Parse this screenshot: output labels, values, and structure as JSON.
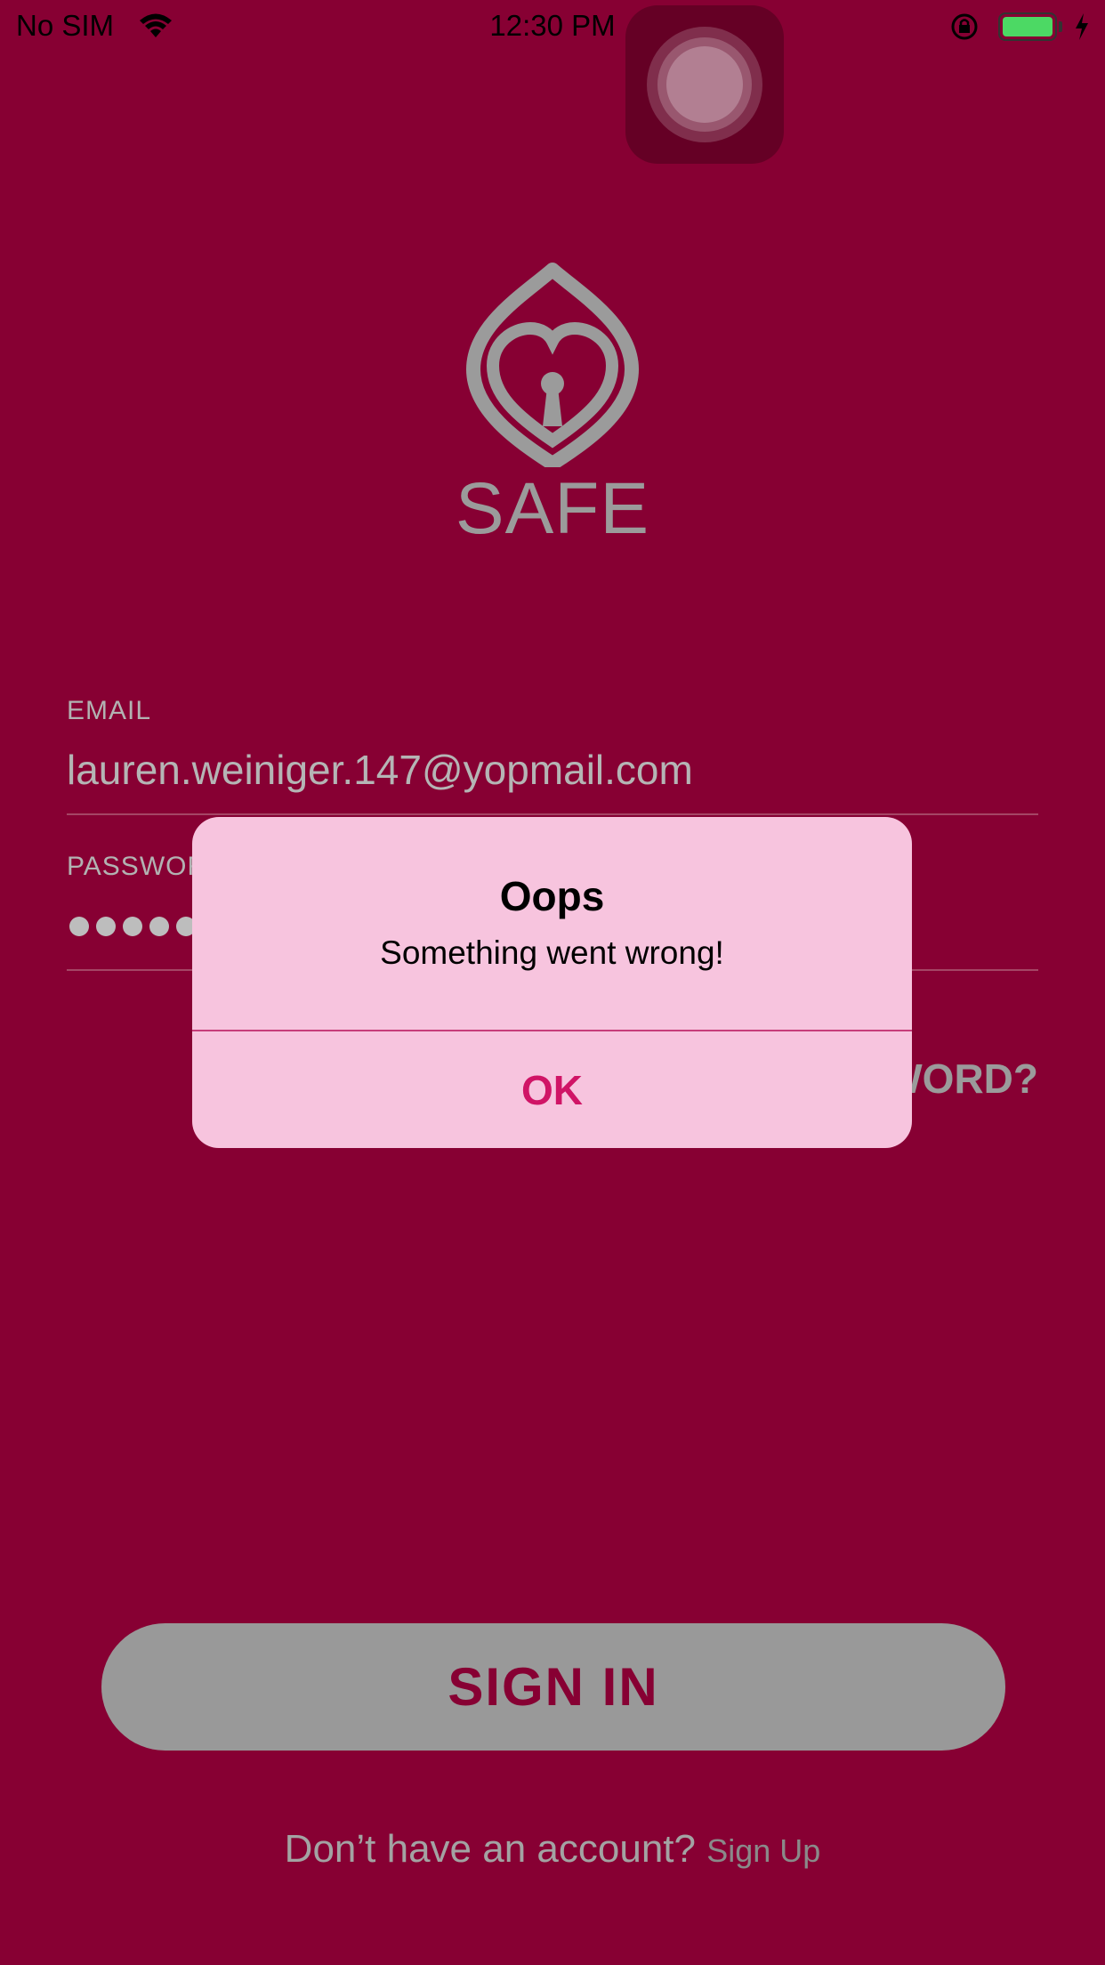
{
  "status_bar": {
    "carrier": "No SIM",
    "time": "12:30 PM"
  },
  "logo": {
    "text": "SAFE"
  },
  "form": {
    "email_label": "EMAIL",
    "email_value": "lauren.weiniger.147@yopmail.com",
    "password_label": "PASSWORD",
    "password_dots": 5,
    "forgot_password": "FORGOT PASSWORD?"
  },
  "signin_label": "SIGN IN",
  "signup": {
    "prompt": "Don’t have an account?",
    "link": "Sign Up"
  },
  "alert": {
    "title": "Oops",
    "message": "Something went wrong!",
    "ok_label": "OK"
  },
  "colors": {
    "background": "#870033",
    "alert_background": "#f7c4de",
    "alert_button": "#d01466",
    "signin_button": "#999999",
    "battery": "#4cd964"
  }
}
